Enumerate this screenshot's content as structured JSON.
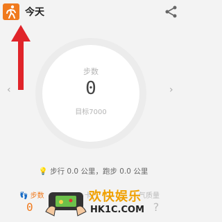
{
  "header": {
    "title": "今天"
  },
  "ring": {
    "label": "步数",
    "value": "0",
    "goal": "目标7000"
  },
  "summary": {
    "text": "步行 0.0 公里，跑步 0.0 公里"
  },
  "bottom": {
    "left_label": "步数",
    "left_value": "0",
    "middle_label": "卡",
    "right_label": "气质量",
    "right_value": "?"
  },
  "watermark": {
    "text": "欢快娱乐",
    "url": "HK1C.COM"
  },
  "colors": {
    "accent": "#f07a1e",
    "arrow": "#e0242a"
  }
}
